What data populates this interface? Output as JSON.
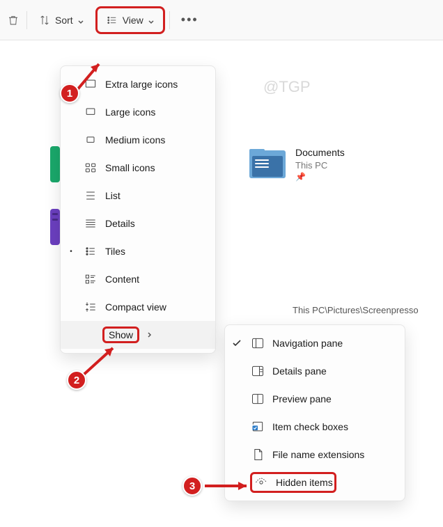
{
  "toolbar": {
    "sort_label": "Sort",
    "view_label": "View"
  },
  "watermark": "@TGP",
  "view_menu": {
    "items": [
      {
        "label": "Extra large icons"
      },
      {
        "label": "Large icons"
      },
      {
        "label": "Medium icons"
      },
      {
        "label": "Small icons"
      },
      {
        "label": "List"
      },
      {
        "label": "Details"
      },
      {
        "label": "Tiles"
      },
      {
        "label": "Content"
      },
      {
        "label": "Compact view"
      },
      {
        "label": "Show"
      }
    ]
  },
  "show_submenu": {
    "items": [
      {
        "label": "Navigation pane",
        "checked": true
      },
      {
        "label": "Details pane"
      },
      {
        "label": "Preview pane"
      },
      {
        "label": "Item check boxes"
      },
      {
        "label": "File name extensions"
      },
      {
        "label": "Hidden items"
      }
    ]
  },
  "file": {
    "name": "Documents",
    "location": "This PC"
  },
  "path": "This PC\\Pictures\\Screenpresso",
  "annotations": {
    "a1": "1",
    "a2": "2",
    "a3": "3"
  }
}
